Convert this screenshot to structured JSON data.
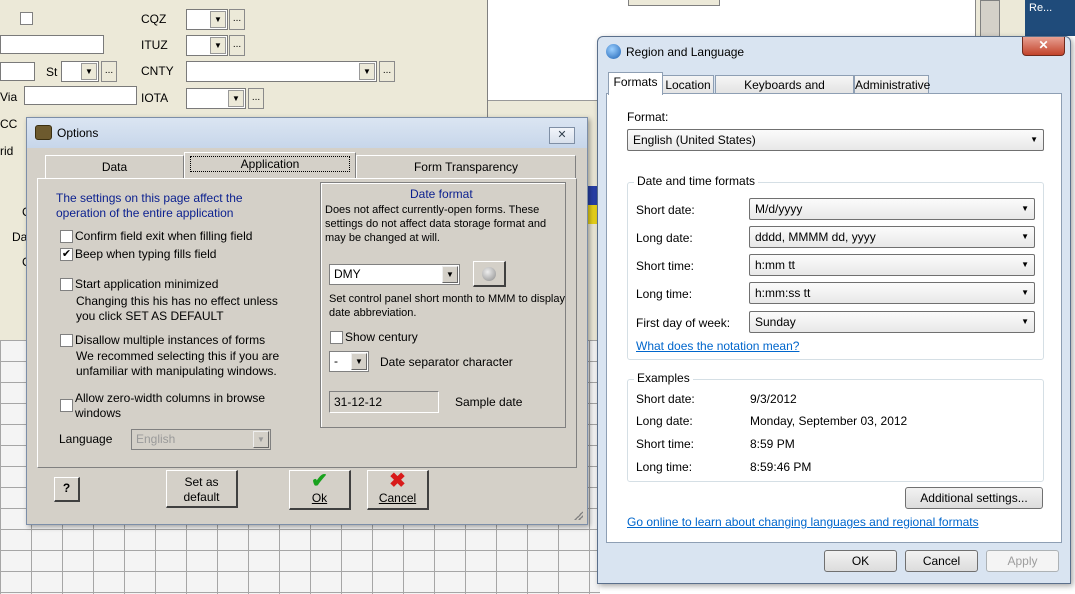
{
  "background_form": {
    "fields": {
      "cqz": "CQZ",
      "ituz": "ITUZ",
      "cnty": "CNTY",
      "iota": "IOTA",
      "st": "St",
      "via": "Via",
      "cc": "CC",
      "grid": "rid",
      "c1": "C",
      "da": "Da",
      "c2": "C"
    },
    "dots": "...",
    "right_window_title": "Re..."
  },
  "options": {
    "title": "Options",
    "close": "✕",
    "tabs": [
      {
        "label": "Data",
        "active": false
      },
      {
        "label": "Application",
        "active": true
      },
      {
        "label": "Form Transparency",
        "active": false
      }
    ],
    "intro_line1": "The settings on this page affect the",
    "intro_line2": "operation of the entire application",
    "checks": {
      "confirm_exit": {
        "label": "Confirm field exit when filling field",
        "checked": false
      },
      "beep": {
        "label": "Beep when typing fills field",
        "checked": true
      },
      "start_min": {
        "label": "Start application minimized",
        "checked": false,
        "note1": "Changing this his has no effect unless",
        "note2": "you click SET AS DEFAULT"
      },
      "disallow": {
        "label": "Disallow multiple instances of forms",
        "checked": false,
        "note1": "We recommed selecting this if you are",
        "note2": "unfamiliar with manipulating windows."
      },
      "zero_width": {
        "label": "Allow zero-width columns in browse",
        "label2": "windows",
        "checked": false
      }
    },
    "language_label": "Language",
    "language_value": "English",
    "date_format": {
      "title": "Date format",
      "desc1": "Does not affect currently-open forms.  These",
      "desc2": "settings do not affect data storage format and",
      "desc3": "may be changed at will.",
      "format_value": "DMY",
      "note": "Set control panel short month to MMM to display",
      "note2": "date abbreviation.",
      "show_century": "Show century",
      "separator_value": "-",
      "separator_label": "Date separator character",
      "sample_value": "31-12-12",
      "sample_label": "Sample date"
    },
    "buttons": {
      "help": "?",
      "set_default_1": "Set as",
      "set_default_2": "default",
      "ok": "Ok",
      "cancel": "Cancel"
    }
  },
  "region": {
    "title": "Region and Language",
    "close": "✕",
    "tabs": [
      {
        "label": "Formats",
        "active": true
      },
      {
        "label": "Location",
        "active": false
      },
      {
        "label": "Keyboards and Languages",
        "active": false
      },
      {
        "label": "Administrative",
        "active": false
      }
    ],
    "format_label": "Format:",
    "format_value": "English (United States)",
    "dt_group": "Date and time formats",
    "rows": [
      {
        "label": "Short date:",
        "value": "M/d/yyyy"
      },
      {
        "label": "Long date:",
        "value": "dddd, MMMM dd, yyyy"
      },
      {
        "label": "Short time:",
        "value": "h:mm tt"
      },
      {
        "label": "Long time:",
        "value": "h:mm:ss tt"
      },
      {
        "label": "First day of week:",
        "value": "Sunday"
      }
    ],
    "notation_link": "What does the notation mean?",
    "examples_group": "Examples",
    "examples": [
      {
        "label": "Short date:",
        "value": "9/3/2012"
      },
      {
        "label": "Long date:",
        "value": "Monday, September 03, 2012"
      },
      {
        "label": "Short time:",
        "value": "8:59 PM"
      },
      {
        "label": "Long time:",
        "value": "8:59:46 PM"
      }
    ],
    "additional_button": "Additional settings...",
    "online_link": "Go online to learn about changing languages and regional formats",
    "buttons": {
      "ok": "OK",
      "cancel": "Cancel",
      "apply": "Apply"
    }
  }
}
